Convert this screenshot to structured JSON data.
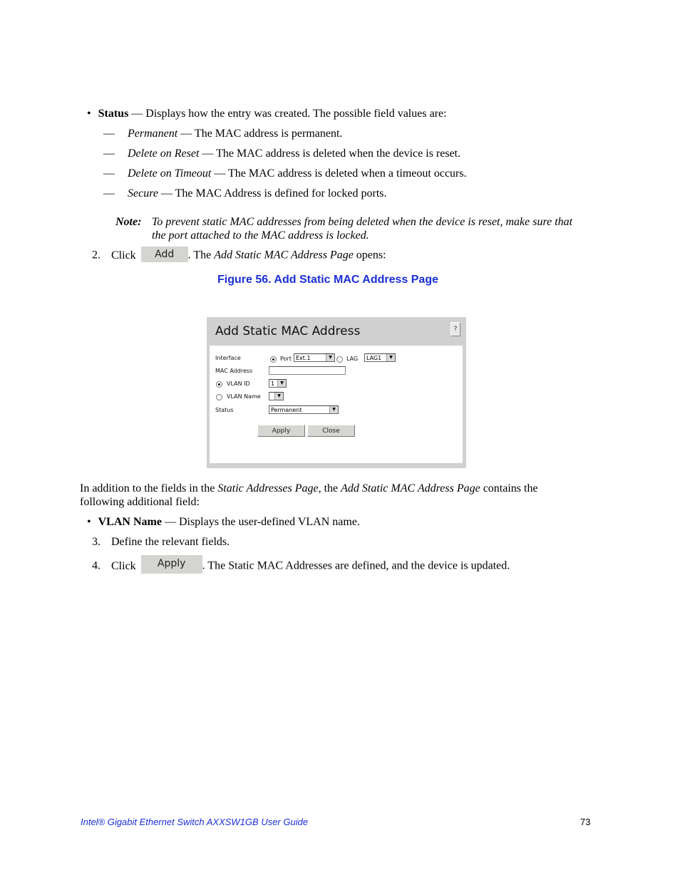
{
  "status_section": {
    "term": "Status",
    "description": " — Displays how the entry was created. The possible field values are:",
    "values": [
      {
        "term": "Permanent",
        "description": " — The MAC address is permanent."
      },
      {
        "term": "Delete on Reset",
        "description": " — The MAC address is deleted when the device is reset."
      },
      {
        "term": "Delete on Timeout",
        "description": " — The MAC address is deleted when a timeout occurs."
      },
      {
        "term": "Secure",
        "description": " — The MAC Address is defined for locked ports."
      }
    ]
  },
  "note": {
    "label": "Note:",
    "text": "To prevent static MAC addresses from being deleted when the device is reset, make sure that the port attached to the MAC address is locked."
  },
  "step2": {
    "number": "2.",
    "click": "Click",
    "button_label": "Add",
    "text_pre": ". The ",
    "text_italic": "Add Static MAC Address Page",
    "text_post": " opens:"
  },
  "figure_caption": "Figure 56. Add Static MAC Address Page",
  "dialog": {
    "title": "Add Static MAC Address",
    "help_label": "?",
    "interface_label": "Interface",
    "port_label": "Port",
    "port_value": "Ext.1",
    "lag_label": "LAG",
    "lag_value": "LAG1",
    "mac_address_label": "MAC Address",
    "mac_address_value": "",
    "vlan_id_label": "VLAN ID",
    "vlan_id_value": "1",
    "vlan_name_label": "VLAN Name",
    "vlan_name_value": "",
    "status_label": "Status",
    "status_value": "Permanent",
    "apply_label": "Apply",
    "close_label": "Close",
    "selected_interface": "Port",
    "selected_vlan_mode": "VLAN ID"
  },
  "para": {
    "pre": "In addition to the fields in the ",
    "italic1": "Static Addresses Page",
    "mid": ", the ",
    "italic2": "Add Static MAC Address Page",
    "post": " contains the",
    "line2": "following additional field:"
  },
  "vlan_name_bullet": {
    "term": "VLAN Name",
    "description": " — Displays the user-defined VLAN name."
  },
  "step3": {
    "number": "3.",
    "text": "Define the relevant fields."
  },
  "step4": {
    "number": "4.",
    "click": "Click",
    "button_label": "Apply",
    "text": ". The Static MAC Addresses are defined, and the device is updated."
  },
  "footer": {
    "title": "Intel® Gigabit Ethernet Switch AXXSW1GB User Guide",
    "page_number": "73"
  }
}
